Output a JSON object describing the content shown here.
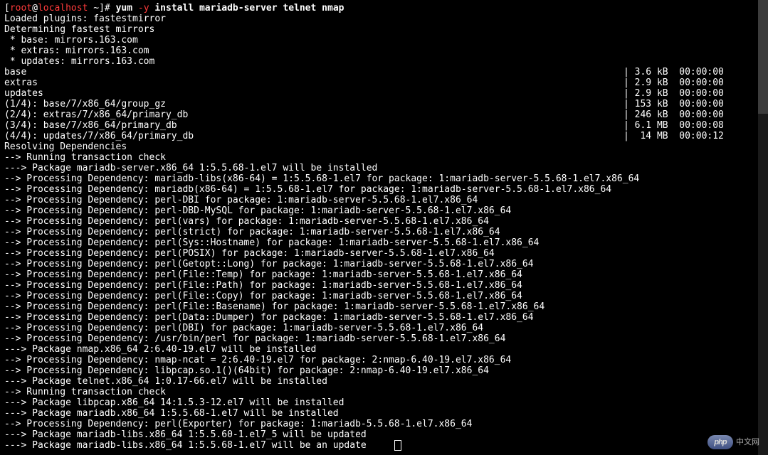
{
  "prompt": {
    "lbracket": "[",
    "user": "root",
    "at": "@",
    "host": "localhost",
    "tilde": " ~",
    "rbracket": "]# ",
    "cmd_bin": "yum",
    "cmd_flag": " -y ",
    "cmd_args": "install mariadb-server telnet nmap"
  },
  "header_lines": [
    "Loaded plugins: fastestmirror",
    "Determining fastest mirrors",
    " * base: mirrors.163.com",
    " * extras: mirrors.163.com",
    " * updates: mirrors.163.com"
  ],
  "repo_rows": [
    {
      "left": "base",
      "right": "| 3.6 kB  00:00:00"
    },
    {
      "left": "extras",
      "right": "| 2.9 kB  00:00:00"
    },
    {
      "left": "updates",
      "right": "| 2.9 kB  00:00:00"
    },
    {
      "left": "(1/4): base/7/x86_64/group_gz",
      "right": "| 153 kB  00:00:00"
    },
    {
      "left": "(2/4): extras/7/x86_64/primary_db",
      "right": "| 246 kB  00:00:00"
    },
    {
      "left": "(3/4): base/7/x86_64/primary_db",
      "right": "| 6.1 MB  00:00:08"
    },
    {
      "left": "(4/4): updates/7/x86_64/primary_db",
      "right": "|  14 MB  00:00:12"
    }
  ],
  "body_lines": [
    "Resolving Dependencies",
    "--> Running transaction check",
    "---> Package mariadb-server.x86_64 1:5.5.68-1.el7 will be installed",
    "--> Processing Dependency: mariadb-libs(x86-64) = 1:5.5.68-1.el7 for package: 1:mariadb-server-5.5.68-1.el7.x86_64",
    "--> Processing Dependency: mariadb(x86-64) = 1:5.5.68-1.el7 for package: 1:mariadb-server-5.5.68-1.el7.x86_64",
    "--> Processing Dependency: perl-DBI for package: 1:mariadb-server-5.5.68-1.el7.x86_64",
    "--> Processing Dependency: perl-DBD-MySQL for package: 1:mariadb-server-5.5.68-1.el7.x86_64",
    "--> Processing Dependency: perl(vars) for package: 1:mariadb-server-5.5.68-1.el7.x86_64",
    "--> Processing Dependency: perl(strict) for package: 1:mariadb-server-5.5.68-1.el7.x86_64",
    "--> Processing Dependency: perl(Sys::Hostname) for package: 1:mariadb-server-5.5.68-1.el7.x86_64",
    "--> Processing Dependency: perl(POSIX) for package: 1:mariadb-server-5.5.68-1.el7.x86_64",
    "--> Processing Dependency: perl(Getopt::Long) for package: 1:mariadb-server-5.5.68-1.el7.x86_64",
    "--> Processing Dependency: perl(File::Temp) for package: 1:mariadb-server-5.5.68-1.el7.x86_64",
    "--> Processing Dependency: perl(File::Path) for package: 1:mariadb-server-5.5.68-1.el7.x86_64",
    "--> Processing Dependency: perl(File::Copy) for package: 1:mariadb-server-5.5.68-1.el7.x86_64",
    "--> Processing Dependency: perl(File::Basename) for package: 1:mariadb-server-5.5.68-1.el7.x86_64",
    "--> Processing Dependency: perl(Data::Dumper) for package: 1:mariadb-server-5.5.68-1.el7.x86_64",
    "--> Processing Dependency: perl(DBI) for package: 1:mariadb-server-5.5.68-1.el7.x86_64",
    "--> Processing Dependency: /usr/bin/perl for package: 1:mariadb-server-5.5.68-1.el7.x86_64",
    "---> Package nmap.x86_64 2:6.40-19.el7 will be installed",
    "--> Processing Dependency: nmap-ncat = 2:6.40-19.el7 for package: 2:nmap-6.40-19.el7.x86_64",
    "--> Processing Dependency: libpcap.so.1()(64bit) for package: 2:nmap-6.40-19.el7.x86_64",
    "---> Package telnet.x86_64 1:0.17-66.el7 will be installed",
    "--> Running transaction check",
    "---> Package libpcap.x86_64 14:1.5.3-12.el7 will be installed",
    "---> Package mariadb.x86_64 1:5.5.68-1.el7 will be installed",
    "--> Processing Dependency: perl(Exporter) for package: 1:mariadb-5.5.68-1.el7.x86_64",
    "---> Package mariadb-libs.x86_64 1:5.5.60-1.el7_5 will be updated",
    "---> Package mariadb-libs.x86_64 1:5.5.68-1.el7 will be an update"
  ],
  "watermark": {
    "logo": "php",
    "text": "中文网"
  }
}
